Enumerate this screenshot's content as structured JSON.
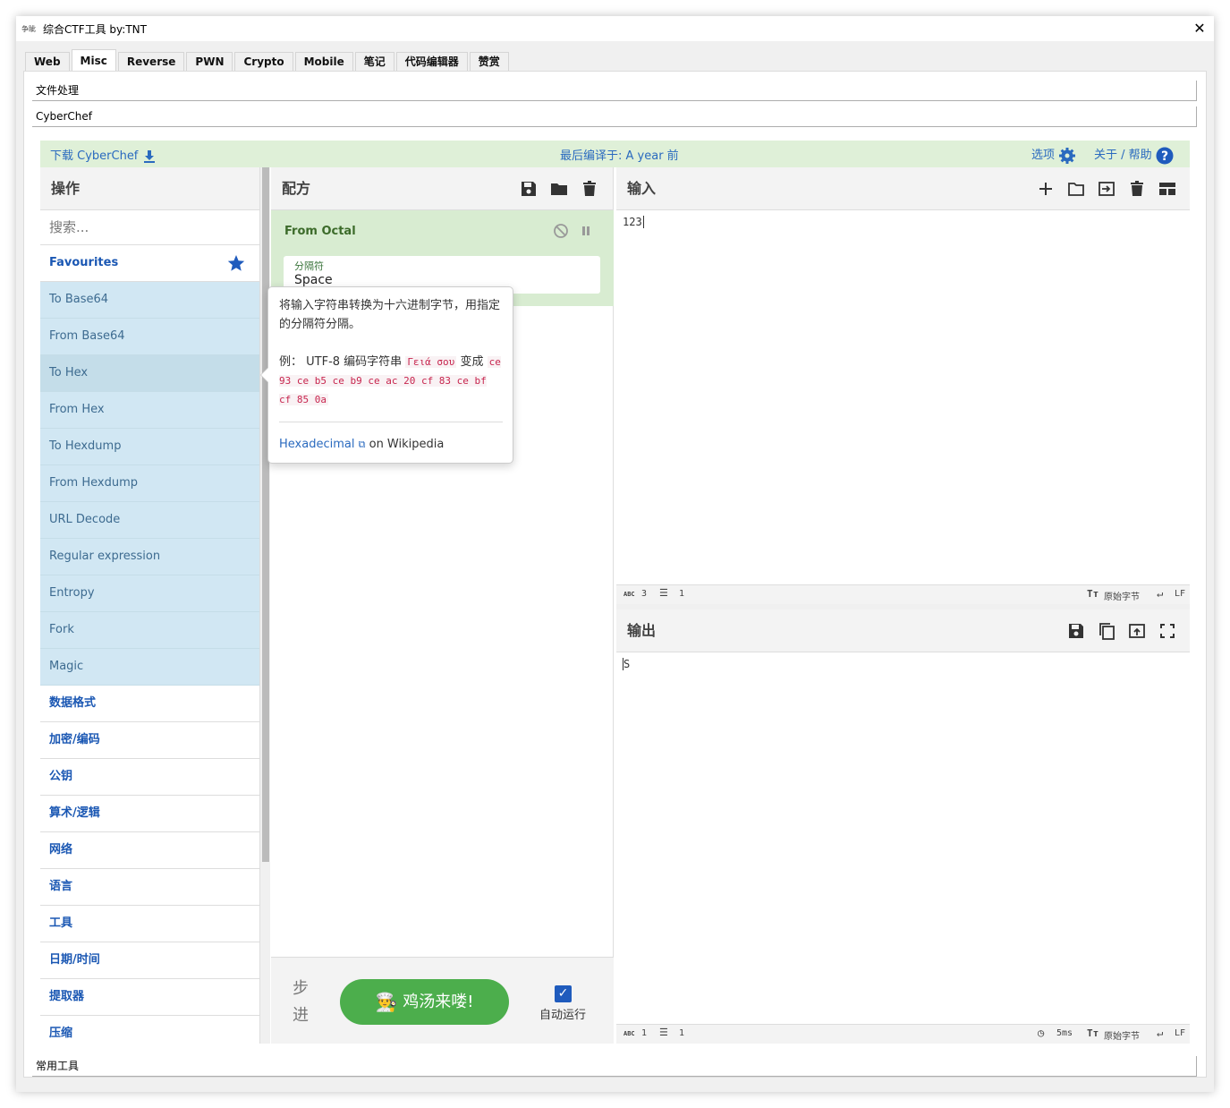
{
  "window": {
    "icon_text": "争眦",
    "title": "综合CTF工具    by:TNT",
    "close_label": "✕"
  },
  "tabs": [
    "Web",
    "Misc",
    "Reverse",
    "PWN",
    "Crypto",
    "Mobile",
    "笔记",
    "代码编辑器",
    "赞赏"
  ],
  "active_tab": "Misc",
  "accordion": {
    "file_processing": "文件处理",
    "cyberchef": "CyberChef",
    "common_tools": "常用工具"
  },
  "banner": {
    "download": "下载 CyberChef",
    "last_build": "最后编译于: A year 前",
    "options": "选项",
    "about": "关于 / 帮助"
  },
  "operations": {
    "title": "操作",
    "search_placeholder": "搜索...",
    "favourites": "Favourites",
    "items": [
      "To Base64",
      "From Base64",
      "To Hex",
      "From Hex",
      "To Hexdump",
      "From Hexdump",
      "URL Decode",
      "Regular expression",
      "Entropy",
      "Fork",
      "Magic"
    ],
    "categories": [
      "数据格式",
      "加密/编码",
      "公钥",
      "算术/逻辑",
      "网络",
      "语言",
      "工具",
      "日期/时间",
      "提取器",
      "压缩"
    ]
  },
  "recipe": {
    "title": "配方",
    "op_name": "From Octal",
    "arg_label": "分隔符",
    "arg_value": "Space",
    "step_label": "步进",
    "bake_label": "鸡汤来喽!",
    "auto_bake_label": "自动运行",
    "auto_bake_checked": true
  },
  "tooltip": {
    "desc": "将输入字符串转换为十六进制字节，用指定的分隔符分隔。",
    "example_prefix": "例：  UTF-8 编码字符串",
    "example_word": "Γειά σου",
    "example_mid": "变成",
    "example_hex": "ce 93 ce b5 ce b9 ce ac 20 cf 83 ce bf cf 85 0a",
    "link_text": "Hexadecimal",
    "link_suffix": "on Wikipedia"
  },
  "input": {
    "title": "输入",
    "value": "123",
    "status": {
      "length": "3",
      "lines": "1",
      "encoding": "原始字节",
      "eol": "LF"
    }
  },
  "output": {
    "title": "输出",
    "value": "S",
    "status": {
      "length": "1",
      "lines": "1",
      "time": "5ms",
      "encoding": "原始字节",
      "eol": "LF"
    }
  },
  "colors": {
    "banner_bg": "#dff0d8",
    "link": "#2a6abf",
    "bake": "#4cae4c",
    "favourite_op_bg": "#d1e7f3",
    "recipe_op_bg": "#d8ecd1"
  }
}
